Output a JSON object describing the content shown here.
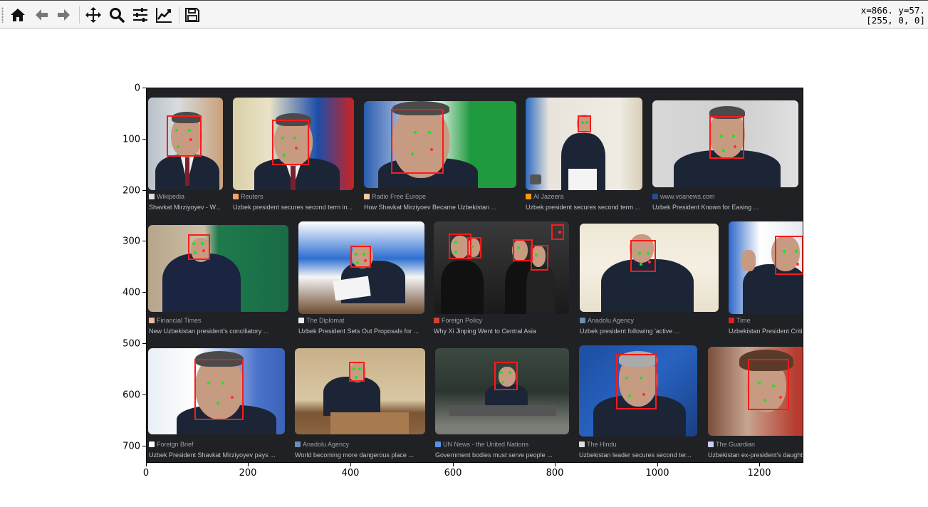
{
  "toolbar": {
    "buttons": [
      {
        "name": "home-icon",
        "label": "Home"
      },
      {
        "name": "back-icon",
        "label": "Back"
      },
      {
        "name": "forward-icon",
        "label": "Forward"
      },
      {
        "name": "pan-icon",
        "label": "Pan"
      },
      {
        "name": "zoom-icon",
        "label": "Zoom"
      },
      {
        "name": "configure-subplots-icon",
        "label": "Configure subplots"
      },
      {
        "name": "edit-axis-icon",
        "label": "Edit axis"
      },
      {
        "name": "save-icon",
        "label": "Save"
      }
    ],
    "coords_line1": "x=866. y=57.",
    "coords_line2": "[255, 0, 0]"
  },
  "axes": {
    "y_ticks": [
      "0",
      "100",
      "200",
      "300",
      "400",
      "500",
      "600",
      "700"
    ],
    "x_ticks": [
      "0",
      "200",
      "400",
      "600",
      "800",
      "1000",
      "1200"
    ]
  },
  "results": [
    {
      "source": "Wikipedia",
      "caption": "Shavkat Mirziyoyev - W...",
      "fav": "#ddd"
    },
    {
      "source": "Reuters",
      "caption": "Uzbek president secures second term in...",
      "fav": "#f5a16a"
    },
    {
      "source": "Radio Free Europe",
      "caption": "How Shavkat Mirziyoev Became Uzbekistan ...",
      "fav": "#f2c9a0"
    },
    {
      "source": "Al Jazeera",
      "caption": "Uzbek president secures second term ...",
      "fav": "#f39c12"
    },
    {
      "source": "www.voanews.com",
      "caption": "Uzbek President Known for Easing ...",
      "fav": "#2a4d8f"
    },
    {
      "source": "Financial Times",
      "caption": "New Uzbekistan president's conciliatory ...",
      "fav": "#f2b79a"
    },
    {
      "source": "The Diplomat",
      "caption": "Uzbek President Sets Out Proposals for ...",
      "fav": "#eee"
    },
    {
      "source": "Foreign Policy",
      "caption": "Why Xi Jinping Went to Central Asia",
      "fav": "#d9412f"
    },
    {
      "source": "Anadolu Agency",
      "caption": "Uzbek president following 'active ...",
      "fav": "#6a8fb8"
    },
    {
      "source": "Time",
      "caption": "Uzbekistan President Critic",
      "fav": "#e02020"
    },
    {
      "source": "Foreign Brief",
      "caption": "Uzbek President Shavkat Mirziyoyev pays ...",
      "fav": "#fff"
    },
    {
      "source": "Anadolu Agency",
      "caption": "World becoming more dangerous place ...",
      "fav": "#6a8fb8"
    },
    {
      "source": "UN News - the United Nations",
      "caption": "Government bodies must serve people ...",
      "fav": "#5b92e5"
    },
    {
      "source": "The Hindu",
      "caption": "Uzbekistan leader secures second ter...",
      "fav": "#ddd"
    },
    {
      "source": "The Guardian",
      "caption": "Uzbekistan ex-president's daughter",
      "fav": "#cce"
    }
  ],
  "colors": {
    "bbox": "#ff1a1a",
    "landmark_green": "#21e021",
    "landmark_red": "#ff3030",
    "results_bg": "#202124"
  }
}
